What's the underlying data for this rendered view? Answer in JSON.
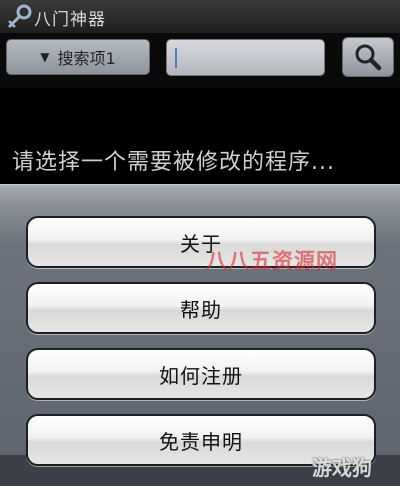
{
  "app": {
    "title": "八门神器",
    "icon": "key-icon"
  },
  "toolbar": {
    "dropdown_label": "搜索项1",
    "dropdown_arrow": "▼",
    "search_value": "",
    "search_icon": "search-icon"
  },
  "main": {
    "prompt": "请选择一个需要被修改的程序..."
  },
  "menu": {
    "items": [
      {
        "label": "关于"
      },
      {
        "label": "帮助"
      },
      {
        "label": "如何注册"
      },
      {
        "label": "免责申明"
      }
    ]
  },
  "watermarks": {
    "red": "八八五资源网",
    "corner": "游戏狗"
  }
}
